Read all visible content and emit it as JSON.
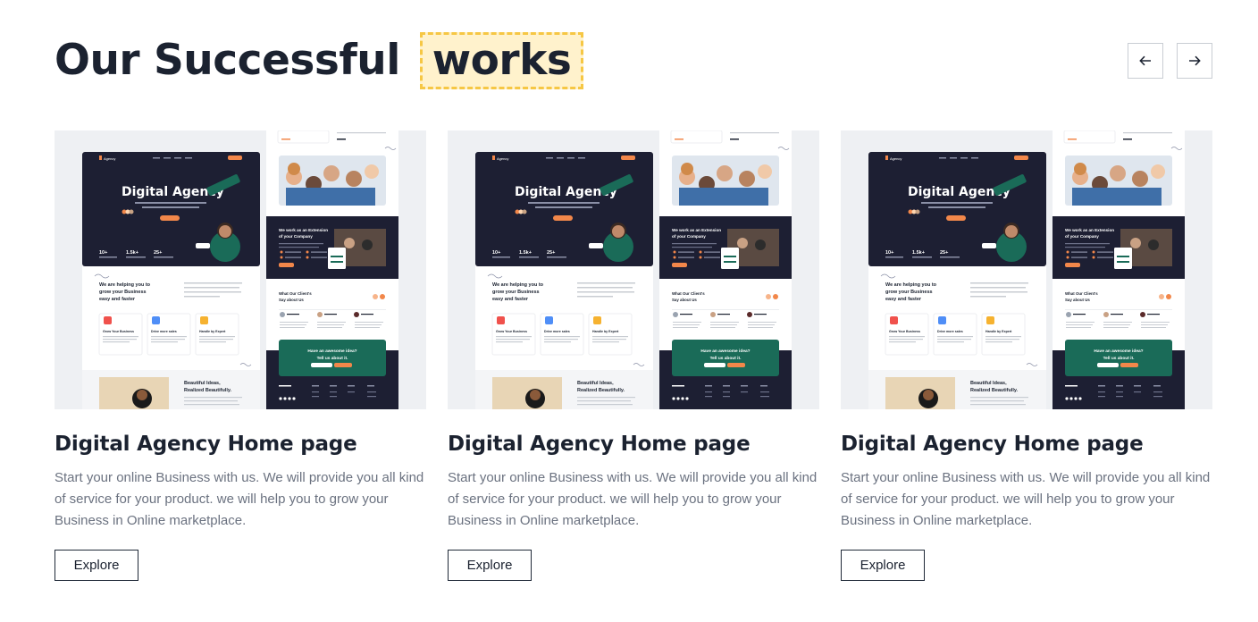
{
  "section": {
    "title_prefix": "Our Successful",
    "title_highlight": "works",
    "highlight_bg": "#fff2cc",
    "highlight_border": "#f6c744"
  },
  "nav": {
    "prev_icon": "arrow-left-icon",
    "next_icon": "arrow-right-icon"
  },
  "preview": {
    "brand": "Agency",
    "hero_title": "Digital Agency",
    "stat_1": "10+",
    "stat_2": "1.5k+",
    "stat_3": "25+",
    "helping_title": "We are helping you to grow your Business easy and faster",
    "service_1": "Grow Your Business",
    "service_2": "Drive more sales",
    "service_3": "Handle by Expert",
    "extension_title": "We work as an Extension of your Company",
    "clients_title": "What Our Client's Say about Us",
    "ideas_title": "Beautiful Ideas, Realized Beautifully.",
    "cta_title": "Have an awesome idea? Tell us about it.",
    "dark_color": "#1d1f33",
    "accent_color": "#f2874a",
    "green_color": "#1a6b58"
  },
  "cards": [
    {
      "title": "Digital Agency Home page",
      "description": "Start your online Business with us. We will provide you all kind of service for your product. we will help you to grow your Business in Online marketplace.",
      "button_label": "Explore"
    },
    {
      "title": "Digital Agency Home page",
      "description": "Start your online Business with us. We will provide you all kind of service for your product. we will help you to grow your Business in Online marketplace.",
      "button_label": "Explore"
    },
    {
      "title": "Digital Agency Home page",
      "description": "Start your online Business with us. We will provide you all kind of service for your product. we will help you to grow your Business in Online marketplace.",
      "button_label": "Explore"
    }
  ]
}
